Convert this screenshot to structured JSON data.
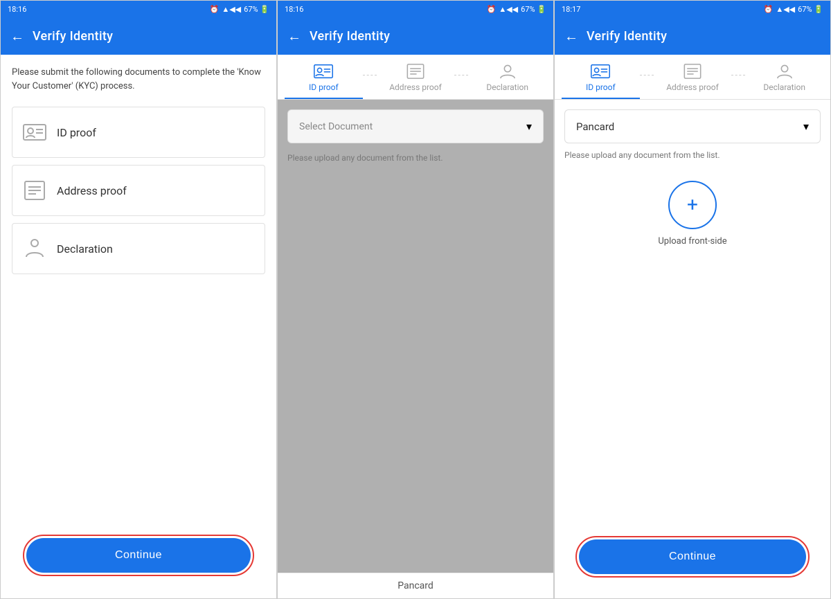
{
  "screen1": {
    "status_time": "18:16",
    "status_icons": "⏰ ▲◀◀ 67%",
    "header_title": "Verify Identity",
    "back_label": "←",
    "description": "Please submit the following documents to complete the 'Know Your Customer' (KYC) process.",
    "items": [
      {
        "id": "id-proof",
        "label": "ID proof"
      },
      {
        "id": "address-proof",
        "label": "Address proof"
      },
      {
        "id": "declaration",
        "label": "Declaration"
      }
    ],
    "continue_label": "Continue"
  },
  "screen2": {
    "status_time": "18:16",
    "header_title": "Verify Identity",
    "back_label": "←",
    "tabs": [
      {
        "id": "id-proof",
        "label": "ID proof",
        "active": true
      },
      {
        "id": "address-proof",
        "label": "Address proof",
        "active": false
      },
      {
        "id": "declaration",
        "label": "Declaration",
        "active": false
      }
    ],
    "select_document_placeholder": "Select Document",
    "upload_hint": "Please upload any document from the list.",
    "bottom_text": "Pancard"
  },
  "screen3": {
    "status_time": "18:17",
    "header_title": "Verify Identity",
    "back_label": "←",
    "tabs": [
      {
        "id": "id-proof",
        "label": "ID proof",
        "active": true
      },
      {
        "id": "address-proof",
        "label": "Address proof",
        "active": false
      },
      {
        "id": "declaration",
        "label": "Declaration",
        "active": false
      }
    ],
    "selected_document": "Pancard",
    "upload_hint": "Please upload any document from the list.",
    "upload_label": "Upload front-side",
    "continue_label": "Continue"
  }
}
